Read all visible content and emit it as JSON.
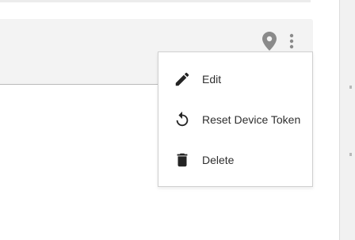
{
  "card": {
    "icons": {
      "location": "location-pin-icon",
      "more": "more-vert-icon"
    }
  },
  "menu": {
    "items": [
      {
        "label": "Edit",
        "icon": "pencil-icon"
      },
      {
        "label": "Reset Device Token",
        "icon": "reset-icon"
      },
      {
        "label": "Delete",
        "icon": "trash-icon"
      }
    ]
  },
  "colors": {
    "card_background": "#f3f3f3",
    "icon_gray": "#8a8a8a",
    "menu_icon": "#242424",
    "menu_text": "#2f2f2f",
    "menu_border": "#cfcfcf"
  }
}
